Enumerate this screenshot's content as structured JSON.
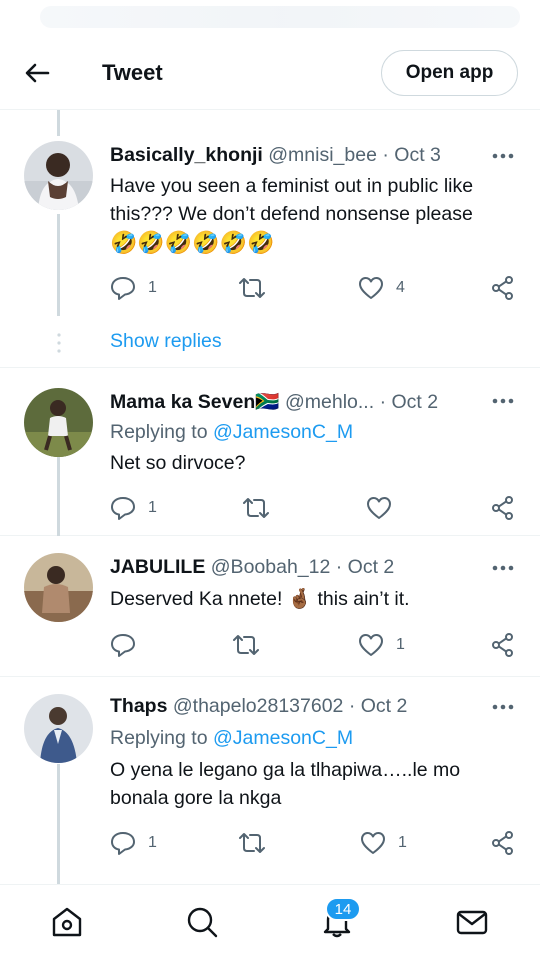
{
  "header": {
    "title": "Tweet",
    "open_app_label": "Open app"
  },
  "thread": {
    "show_replies_label": "Show replies"
  },
  "tweets": [
    {
      "name": "Basically_khonji",
      "handle": "@mnisi_bee",
      "date": "· Oct 3",
      "text": "Have you seen a feminist out in public like this??? We don’t defend nonsense please",
      "emoji": "🤣🤣🤣🤣🤣🤣",
      "replies": "1",
      "retweets": "",
      "likes": "4"
    },
    {
      "name": "Mama ka Seven",
      "flag": "🇿🇦",
      "handle": "@mehlo...",
      "date": "· Oct 2",
      "replying_prefix": "Replying to",
      "replying_handle": "@JamesonC_M",
      "text": "Net so dirvoce?",
      "replies": "1",
      "retweets": "",
      "likes": ""
    },
    {
      "name": "JABULILE",
      "handle": "@Boobah_12",
      "date": "· Oct 2",
      "text_before": "Deserved Ka nnete!",
      "text_emoji": "🤞🏾",
      "text_after": "this ain’t it.",
      "replies": "",
      "retweets": "",
      "likes": "1"
    },
    {
      "name": "Thaps",
      "handle": "@thapelo28137602",
      "date": "· Oct 2",
      "replying_prefix": "Replying to",
      "replying_handle": "@JamesonC_M",
      "text": "O yena le legano ga la tlhapiwa…..le mo bonala gore la nkga",
      "replies": "1",
      "retweets": "",
      "likes": "1"
    }
  ],
  "bottom_nav": {
    "notifications_badge": "14"
  },
  "colors": {
    "accent": "#1d9bf0",
    "text": "#0f1419",
    "muted": "#536471",
    "divider": "#eff3f4"
  }
}
